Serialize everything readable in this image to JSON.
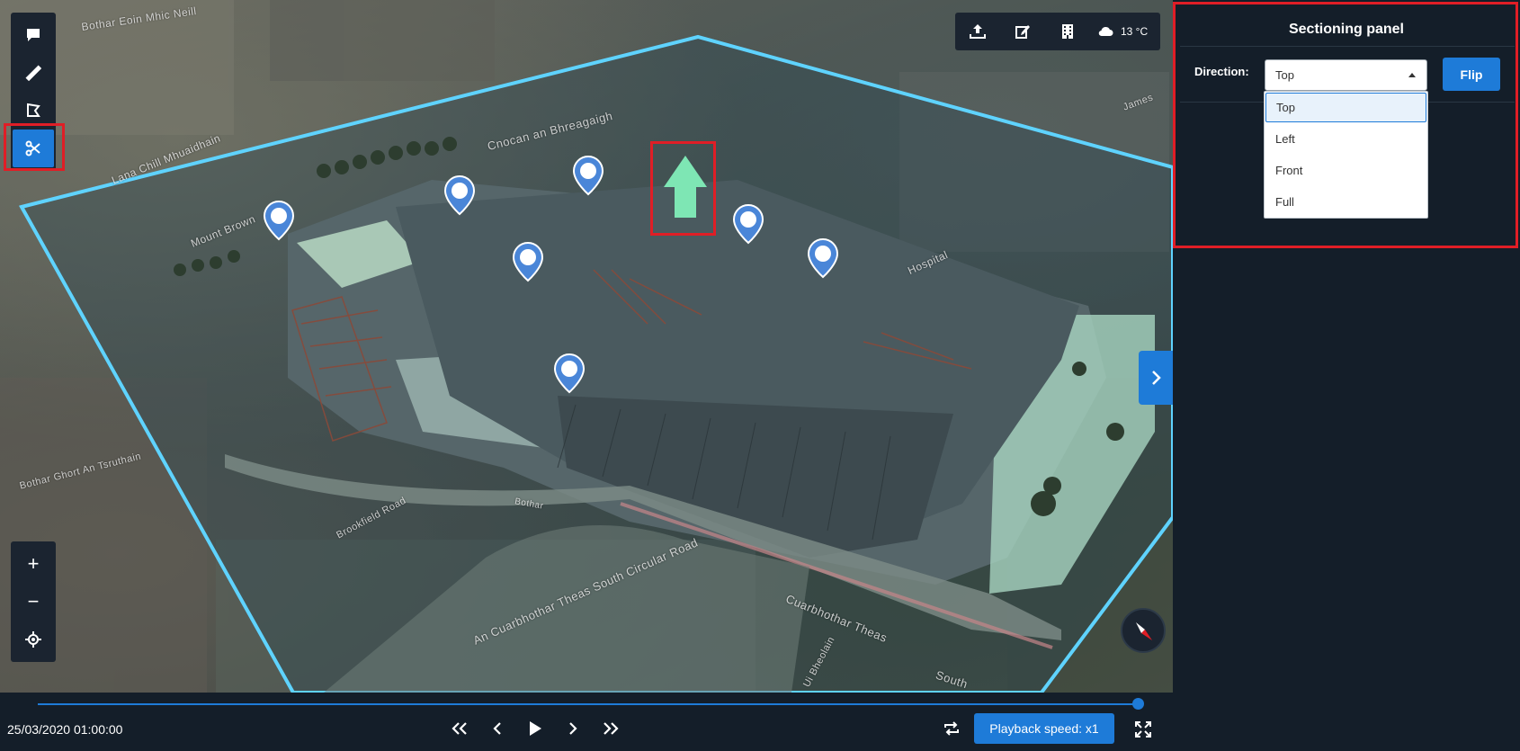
{
  "map": {
    "street_labels": [
      "Bothar Eoin Mhic Neill",
      "Cnocan an Bhreagaigh",
      "Lana Chill Mhuaidhain",
      "Mount Brown",
      "Hospital",
      "Brookfield Road",
      "An Cuarbhothar Theas South Circular Road",
      "Cuarbhothar Theas",
      "Ui Bheolain",
      "South",
      "Bothar Ghort An Tsruthain",
      "Bothar",
      "James"
    ]
  },
  "left_toolbar": {
    "items": [
      "comment-icon",
      "ruler-icon",
      "polygon-icon",
      "scissors-icon"
    ]
  },
  "zoom_toolbar": {
    "zoom_in": "+",
    "zoom_out": "−"
  },
  "top_toolbar": {
    "items": [
      "upload-icon",
      "edit-icon",
      "building-icon"
    ],
    "temperature": "13 °C"
  },
  "timeline": {
    "datetime": "25/03/2020 01:00:00",
    "playback_speed_label": "Playback speed: x1",
    "progress": 0.99
  },
  "panel": {
    "title": "Sectioning panel",
    "direction_label": "Direction:",
    "selected": "Top",
    "flip_label": "Flip",
    "options": [
      "Top",
      "Left",
      "Front",
      "Full"
    ]
  },
  "colors": {
    "accent": "#1e7bd8",
    "highlight": "#e01e26",
    "section_box": "#5fd3ff",
    "arrow": "#7ee6b4"
  }
}
